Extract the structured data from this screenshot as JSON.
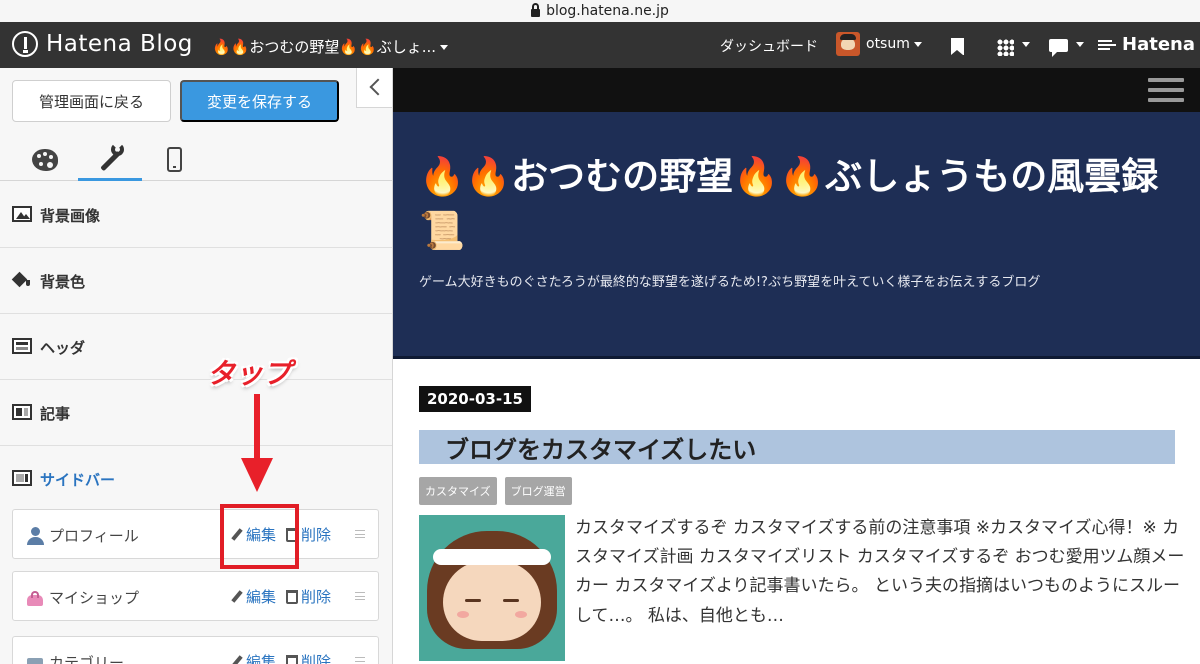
{
  "browser": {
    "url": "blog.hatena.ne.jp"
  },
  "topnav": {
    "brand": "Hatena Blog",
    "blog_selector": "🔥🔥おつむの野望🔥🔥ぶしょ...",
    "dashboard": "ダッシュボード",
    "username": "otsum",
    "hatena": "Hatena"
  },
  "sidebar": {
    "back_button": "管理画面に戻る",
    "save_button": "変更を保存する",
    "tabs": [
      {
        "icon": "palette-icon"
      },
      {
        "icon": "wrench-icon",
        "active": true
      },
      {
        "icon": "smartphone-icon"
      }
    ],
    "sections": [
      {
        "label": "背景画像",
        "icon": "image-icon"
      },
      {
        "label": "背景色",
        "icon": "paint-bucket-icon"
      },
      {
        "label": "ヘッダ",
        "icon": "header-layout-icon"
      },
      {
        "label": "記事",
        "icon": "article-layout-icon"
      },
      {
        "label": "サイドバー",
        "icon": "sidebar-layout-icon",
        "active": true
      }
    ],
    "modules": [
      {
        "name": "プロフィール",
        "icon": "person-icon",
        "edit": "編集",
        "delete": "削除"
      },
      {
        "name": "マイショップ",
        "icon": "shop-bag-icon",
        "edit": "編集",
        "delete": "削除"
      },
      {
        "name": "カテゴリー",
        "icon": "folder-icon",
        "edit": "編集",
        "delete": "削除"
      }
    ]
  },
  "annotation": {
    "tap_label": "タップ",
    "color": "#e11d26"
  },
  "preview": {
    "blog_title": "🔥🔥おつむの野望🔥🔥ぶしょうもの風雲録📜",
    "blog_description": "ゲーム大好きものぐさたろうが最終的な野望を遂げるため!?ぷち野望を叶えていく様子をお伝えするブログ",
    "entry": {
      "date": "2020-03-15",
      "title": "ブログをカスタマイズしたい",
      "categories": [
        "カスタマイズ",
        "ブログ運営"
      ],
      "excerpt": "カスタマイズするぞ カスタマイズする前の注意事項 ※カスタマイズ心得！※ カスタマイズ計画 カスタマイズリスト カスタマイズするぞ おつむ愛用ツム顔メーカー カスタマイズより記事書いたら。 という夫の指摘はいつものようにスルーして…。 私は、自他とも…"
    }
  },
  "colors": {
    "nav_bg": "#333333",
    "save_button": "#3a98e0",
    "header_bg": "#1e2e55",
    "entry_title_bg": "#aec4de",
    "link": "#2a74c0"
  }
}
